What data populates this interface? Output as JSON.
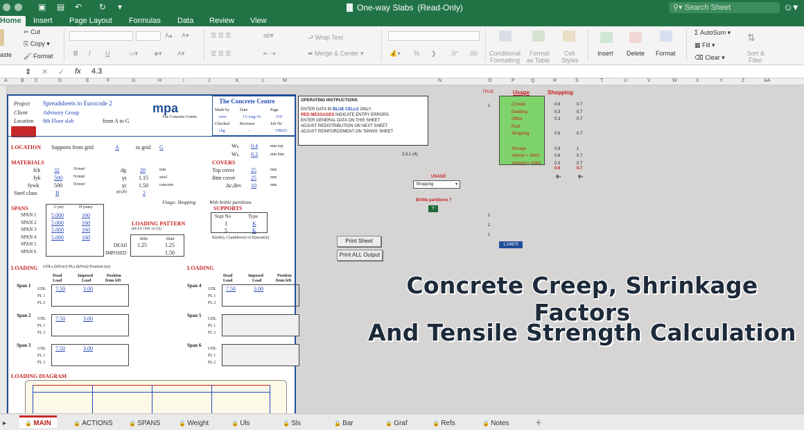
{
  "window": {
    "title": "One-way Slabs",
    "mode": "(Read-Only)",
    "search_placeholder": "Search Sheet"
  },
  "ribbon_tabs": [
    "Home",
    "Insert",
    "Page Layout",
    "Formulas",
    "Data",
    "Review",
    "View"
  ],
  "ribbon": {
    "cut": "Cut",
    "copy": "Copy",
    "format": "Format",
    "paste_partial": "aste",
    "wrap_text": "Wrap Text",
    "merge_center": "Merge & Center",
    "cond_formatting_1": "Conditional",
    "cond_formatting_2": "Formatting",
    "format_table_1": "Format",
    "format_table_2": "as Table",
    "cell_styles_1": "Cell",
    "cell_styles_2": "Styles",
    "insert": "Insert",
    "delete": "Delete",
    "format_cells": "Format",
    "autosum": "AutoSum",
    "fill": "Fill",
    "clear": "Clear",
    "sort_1": "Sort &",
    "sort_2": "Filter",
    "bold": "B",
    "italic": "I",
    "underline": "U",
    "percent": "%"
  },
  "formula_bar": {
    "fx": "fx",
    "value": "4.3"
  },
  "columns": [
    "A",
    "B",
    "C",
    "D",
    "E",
    "F",
    "G",
    "H",
    "I",
    "J",
    "K",
    "L",
    "M",
    "N",
    "O",
    "P",
    "Q",
    "R",
    "S",
    "T",
    "U",
    "V",
    "W",
    "X",
    "Y",
    "Z",
    "AA"
  ],
  "panel": {
    "project_label": "Project",
    "project": "Spreadsheets to Eurocode 2",
    "client_label": "Client",
    "client": "Advisory Group",
    "location_label": "Location",
    "location": "8th Floor slab",
    "from_to": "from A to G",
    "logo": "mpa",
    "logo_sub": "The Concrete Centre",
    "centre_title": "The Concrete Centre",
    "made_by_label": "Made by",
    "made_by": "rmw",
    "date_label": "Date",
    "date": "15-Aug-16",
    "page_label": "Page",
    "page": "210",
    "checked_label": "Checked",
    "checked": "chg",
    "revision_label": "Revision",
    "revision": "-",
    "job_label": "Job No",
    "job": "FB625",
    "location_heading": "LOCATION",
    "supports_from": "Supports from grid",
    "grid_from": "A",
    "to_grid": "to grid",
    "grid_to": "G",
    "wk_label": "Wₖ",
    "wk_top": "0.4",
    "wk_btm": "0.3",
    "mm_top": "mm top",
    "mm_btm": "mm btm",
    "materials_heading": "MATERIALS",
    "fck_label": "fck",
    "fck": "32",
    "fyk_label": "fyk",
    "fyk": "500",
    "fywk_label": "fywk",
    "fywk": "500",
    "steel_label": "Steel class",
    "steel": "B",
    "unit_nmm": "N/mm²",
    "dg_label": "dg",
    "dg": "20",
    "gs_label": "γs",
    "gs": "1.15",
    "gc_label": "γc",
    "gc": "1.50",
    "phi_label": "φ(t,t0)",
    "phi": "2",
    "mm": "mm",
    "steel_word": "steel",
    "concrete_word": "concrete",
    "covers_heading": "COVERS",
    "top_cover_label": "Top cover",
    "top_cover": "25",
    "btm_cover_label": "Btm cover",
    "btm_cover": "25",
    "dc_label": "Δc,dev",
    "dc": "10",
    "usage_note": "Usage: Shopping",
    "brittle_note": "With brittle partitions",
    "spans_heading": "SPANS",
    "spans_header_l": "L (m)",
    "spans_header_h": "H (mm)",
    "spans": [
      {
        "label": "SPAN 1",
        "l": "5.000",
        "h": "160"
      },
      {
        "label": "SPAN 2",
        "l": "5.000",
        "h": "160"
      },
      {
        "label": "SPAN 3",
        "l": "5.000",
        "h": "160"
      },
      {
        "label": "SPAN 4",
        "l": "5.000",
        "h": "160"
      },
      {
        "label": "SPAN 5",
        "l": "",
        "h": ""
      },
      {
        "label": "SPAN 6",
        "l": "",
        "h": ""
      }
    ],
    "loading_pattern": "LOADING PATTERN",
    "bs_note": "(BS EN 1990: (6.10))",
    "min": "min",
    "max": "max",
    "dead": "DEAD",
    "dead_min": "1.25",
    "dead_max": "1.25",
    "imposed": "IMPOSED",
    "imposed_max": "1.50",
    "supports_heading": "SUPPORTS",
    "supt_no": "Supt No",
    "type": "Type",
    "supt1": "1",
    "supt1_type": "K",
    "supt5": "5",
    "supt5_type": "K",
    "supports_note": "K(nife), C(antilever) or E(ncastre)",
    "loading_heading": "LOADING",
    "loading_sub": "UDLs (kN/m²)  PLs (kN/m)  Position (m)",
    "load_dead": "Dead",
    "load_dead2": "Load",
    "load_imposed": "Imposed",
    "load_imposed2": "Load",
    "load_position": "Position",
    "load_position2": "from left",
    "udl": "UDL",
    "pl1": "PL 1",
    "pl2": "PL 2",
    "span1": "Span 1",
    "span2": "Span 2",
    "span3": "Span 3",
    "span4": "Span 4",
    "span5": "Span 5",
    "span6": "Span 6",
    "udl_dead": "7.50",
    "udl_imposed": "3.00",
    "diagram_heading": "LOADING DIAGRAM"
  },
  "instructions": {
    "title": "OPERATING INSTRUCTIONS",
    "line1_a": "ENTER DATA IN ",
    "line1_b": "BLUE CELLS",
    "line1_c": " ONLY.",
    "line2_a": "RED MESSAGES",
    "line2_b": " INDICATE ENTRY ERRORS.",
    "line3": "ENTER GENERAL DATA ON THIS SHEET",
    "line4": "ADJUST REDISTRIBUTION ON NEXT SHEET",
    "line5": "ADJUST REINFORCEMENT ON 'SPANS' SHEET"
  },
  "side": {
    "true_label": "TRUE",
    "one": "1",
    "usage_header": "Usage",
    "shopping_header": "Shopping",
    "ref": "3.3.1 (4)",
    "usage_table": [
      {
        "name": "Crowds",
        "a": "0.6",
        "b": "0.7"
      },
      {
        "name": "Dwelling",
        "a": "0.3",
        "b": "0.7"
      },
      {
        "name": "Office",
        "a": "0.3",
        "b": "0.7"
      },
      {
        "name": "Roof",
        "a": "",
        "b": ""
      },
      {
        "name": "Shopping",
        "a": "0.6",
        "b": "0.7"
      },
      {
        "name": "",
        "a": "",
        "b": ""
      },
      {
        "name": "Storage",
        "a": "0.8",
        "b": "1"
      },
      {
        "name": "Vehicle < 30kN",
        "a": "0.6",
        "b": "0.7"
      },
      {
        "name": "Vehicle>= 30kN",
        "a": "0.3",
        "b": "0.7"
      }
    ],
    "red_a": "0.6",
    "red_b": "0.7",
    "psi": "ψ₂",
    "usage_label": "USAGE",
    "usage_select": "Shopping",
    "brittle_label": "Brittle partitions ?",
    "brittle_value": "Y",
    "value_box": "1.24875",
    "print_sheet": "Print Sheet",
    "print_all": "Print ALL Output"
  },
  "overlay": {
    "line1": "Concrete Creep, Shrinkage Factors",
    "line2": "And Tensile Strength Calculation"
  },
  "sheet_tabs": [
    "MAIN",
    "ACTIONS",
    "SPANS",
    "Weight",
    "Uls",
    "Sls",
    "Bar",
    "Graf",
    "Refs",
    "Notes"
  ],
  "colors": {
    "excel_green": "#217346",
    "panel_blue": "#1f4e96",
    "usage_green": "#7ed36a",
    "error_red": "#c41e1e"
  }
}
